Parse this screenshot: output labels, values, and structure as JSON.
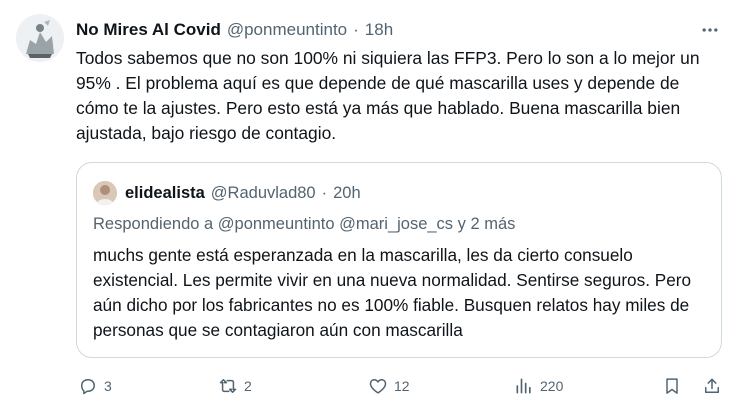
{
  "tweet": {
    "author_name": "No Mires Al Covid",
    "author_handle": "@ponmeuntinto",
    "separator": "·",
    "time": "18h",
    "text": "Todos sabemos que no son 100% ni siquiera las FFP3. Pero lo son a lo mejor un 95% . El problema aquí es que depende de qué mascarilla uses y depende de cómo te la ajustes. Pero esto está ya más que hablado. Buena mascarilla bien ajustada, bajo riesgo de contagio."
  },
  "quote": {
    "author_name": "elidealista",
    "author_handle": "@Raduvlad80",
    "separator": "·",
    "time": "20h",
    "replying_prefix": "Respondiendo a",
    "replying_handles": "@ponmeuntinto @mari_jose_cs",
    "replying_suffix": "y 2 más",
    "text": "muchs gente está esperanzada en la mascarilla, les da cierto consuelo existencial. Les permite vivir en una nueva normalidad. Sentirse seguros. Pero aún dicho por los fabricantes no es 100% fiable. Busquen relatos hay miles de personas que se contagiaron aún con mascarilla"
  },
  "actions": {
    "replies": "3",
    "reposts": "2",
    "likes": "12",
    "views": "220"
  },
  "icons": {
    "more": "more-icon",
    "reply": "reply-icon",
    "repost": "repost-icon",
    "like": "like-icon",
    "views": "views-icon",
    "bookmark": "bookmark-icon",
    "share": "share-icon"
  },
  "colors": {
    "text": "#0f1419",
    "secondary": "#536471",
    "border": "#cfd9de"
  }
}
